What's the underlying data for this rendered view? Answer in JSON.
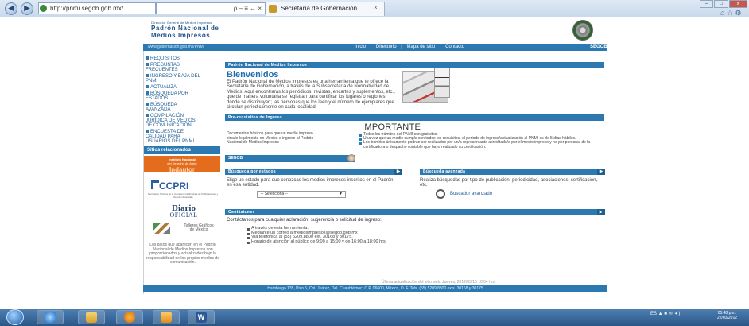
{
  "browser": {
    "url": "http://pnmi.segob.gob.mx/",
    "search_text": "ρ – ≡ ← ×",
    "tab_title": "Secretaría de Gobernación",
    "tab_close": "×",
    "back": "◀",
    "forward": "▶",
    "window_controls": [
      "–",
      "□",
      "x"
    ],
    "tools": "⌂ ☆ ⚙"
  },
  "header": {
    "subtitle": "Dirección General de Medios Impresos",
    "title_line1": "Padrón Nacional de",
    "title_line2": "Medios Impresos",
    "site_url": "www.gobernacion.gob.mx/PNMI",
    "nav": [
      "Inicio",
      "|",
      "Directorio",
      "|",
      "Mapa de sitio",
      "|",
      "Contacto"
    ],
    "brand": "SEGOB"
  },
  "sidebar": {
    "items": [
      "REQUISITOS",
      "PREGUNTAS FRECUENTES",
      "INGRESO Y BAJA DEL PNMI",
      "ACTUALIZA",
      "BÚSQUEDA POR ESTADOS",
      "BÚSQUEDA AVANZADA",
      "COMPILACIÓN JURÍDICA DE MEDIOS DE COMUNICACIÓN",
      "ENCUESTA DE CALIDAD PARA USUARIOS DEL PNMI"
    ],
    "related_title": "Sitios relacionados",
    "inai_line1": "Instituto Nacional",
    "inai_line2": "del Derecho de Autor",
    "inai_line3": "Indautor",
    "ccpri": "CCPRI",
    "ccpri_sub": "Secretaría Técnica de la Comisión Calificadora de Publicaciones y Revistas Ilustradas",
    "diario1": "Diario",
    "diario2": "OFICIAL",
    "talleres": "Talleres Gráficos de México",
    "disclaimer": "Los datos que aparecen en el Padrón Nacional de Medios Impresos son proporcionados y actualizados bajo la responsabilidad de los propios medios de comunicación."
  },
  "main": {
    "pnm_bar": "Padrón Nacional de Medios Impresos",
    "welcome_title": "Bienvenidos",
    "welcome_text": "El Padrón Nacional de Medios Impresos es una herramienta que te ofrece la Secretaría de Gobernación, a través de la Subsecretaría de Normatividad de Medios. Aquí encontrarás los periódicos, revistas, encartes y suplementos, etc., que de manera voluntaria se registran para certificar los lugares o regiones donde se distribuyen; las personas que los leen y el número de ejemplares que circulan periódicamente en cada localidad.",
    "prereq_bar": "Pre-requisitos de Ingreso",
    "prereq_text": "Documentos básicos para que un medio impreso circule legalmente en México e ingrese al Padrón Nacional de Medios Impresos",
    "important_title": "IMPORTANTE",
    "important_items": [
      "Todos los trámites del PNMI son gratuitos.",
      "Una vez que un medio cumple con todos los requisitos, el periodo de ingreso/actualización al PNMI es de 5 días hábiles.",
      "Los trámites únicamente podrán ser realizados por un/a representante acreditado/a por el medio impreso y no por personal de la certificadora o despacho contable que haya realizado su certificación."
    ],
    "segob_bar": "SEGOB",
    "states_bar": "Búsqueda por estados",
    "states_text": "Elige un estado para que conozcas los medios impresos inscritos en el Padrón en esa entidad.",
    "states_select": "-- Selecciona --",
    "adv_bar": "Búsqueda avanzada",
    "adv_text": "Realiza búsquedas por tipo de publicación, periodicidad, asociaciones, certificación, etc.",
    "adv_link": "Buscador avanzado",
    "contact_bar": "Contáctanos",
    "contact_text": "Contáctanos para cualquier aclaración, sugerencia o solicitud de ingreso:",
    "contact_items": [
      "A través de esta herramienta.",
      "Mediante un correo a mediosimpresos@segob.gob.mx",
      "Vía telefónica al (55) 5209.8800 ext. 30168 y 30175.",
      "Horario de atención al público de 9:00 a 15:00 y de 16:00 a 18:00 hrs."
    ],
    "arrow": "▶",
    "last_update": "Última actualización del sitio web: Jueves, 2012/03/15 10:54 hrs.",
    "footer": "Hamburgo 135, Piso 5, Col. Juárez, Del. Cuauhtémoc, C.P. 06600, México, D. F. Tels. (55) 5209.8800 exts. 30168 y 30175"
  },
  "taskbar": {
    "tray": "ES  ▲  ■  ✉  ◄)",
    "time": "05:48 p.m.",
    "date": "22/03/2012"
  },
  "colors": {
    "accent": "#2b79b0",
    "orange": "#e46c1d",
    "title_blue": "#1e4f86"
  }
}
